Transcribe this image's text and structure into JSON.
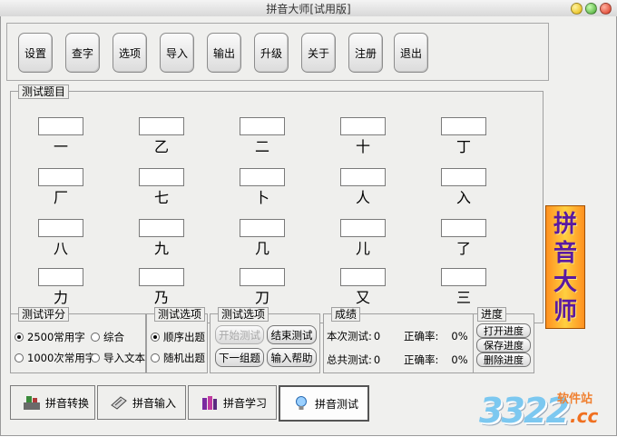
{
  "window": {
    "title": "拼音大师[试用版]"
  },
  "toolbar": {
    "buttons": [
      "设置",
      "查字",
      "选项",
      "导入",
      "输出",
      "升级",
      "关于",
      "注册",
      "退出"
    ]
  },
  "test_questions": {
    "label": "测试题目",
    "chars": [
      "一",
      "乙",
      "二",
      "十",
      "丁",
      "厂",
      "七",
      "卜",
      "人",
      "入",
      "八",
      "九",
      "几",
      "儿",
      "了",
      "力",
      "乃",
      "刀",
      "又",
      "三"
    ]
  },
  "score_panel": {
    "label": "测试评分",
    "opt_2500": "2500常用字",
    "opt_comprehensive": "综合",
    "opt_1000": "1000次常用字",
    "opt_import": "导入文本"
  },
  "test_options": {
    "label": "测试选项",
    "opt_order": "顺序出题",
    "opt_random": "随机出题"
  },
  "test_controls": {
    "label": "测试选项",
    "start": "开始测试",
    "end": "结束测试",
    "next": "下一组题",
    "help": "输入帮助"
  },
  "results": {
    "label": "成绩",
    "this_label": "本次测试:",
    "this_value": "0",
    "this_rate_label": "正确率:",
    "this_rate": "0%",
    "total_label": "总共测试:",
    "total_value": "0",
    "total_rate_label": "正确率:",
    "total_rate": "0%"
  },
  "progress": {
    "label": "进度",
    "open": "打开进度",
    "save": "保存进度",
    "delete": "删除进度"
  },
  "tabs": [
    "拼音转换",
    "拼音输入",
    "拼音学习",
    "拼音测试"
  ],
  "banner": [
    "拼",
    "音",
    "大",
    "师"
  ],
  "watermark": {
    "number": "3322",
    "site": "软件站",
    "domain": ".cc"
  }
}
